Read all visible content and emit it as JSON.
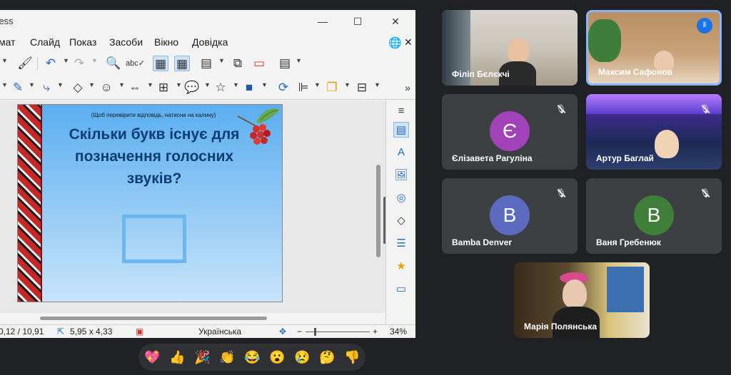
{
  "impress": {
    "title": "ress",
    "menu": [
      "мат",
      "Слайд",
      "Показ",
      "Засоби",
      "Вікно",
      "Довідка"
    ]
  },
  "slide": {
    "hint": "(Щоб перевірити відповідь, натисни на калину)",
    "title": "Скільки букв існує для позначення голосних звуків?"
  },
  "status": {
    "position": "0,12 / 10,91",
    "size": "5,95 x 4,33",
    "language": "Українська",
    "zoom": "34%"
  },
  "participants": [
    {
      "name": "Філіп Бєлєкчі",
      "type": "video"
    },
    {
      "name": "Максим Сафонов",
      "type": "video",
      "speaking": true
    },
    {
      "name": "Єлізавета Рагуліна",
      "type": "avatar",
      "initial": "Є",
      "color": "#a142b8",
      "muted": true
    },
    {
      "name": "Артур Баглай",
      "type": "video",
      "muted": true
    },
    {
      "name": "Bamba Denver",
      "type": "avatar",
      "initial": "B",
      "color": "#5c6bc0",
      "muted": true
    },
    {
      "name": "Ваня Гребенюк",
      "type": "avatar",
      "initial": "B",
      "color": "#3f7f3a",
      "muted": true
    },
    {
      "name": "Марія Полянська",
      "type": "video"
    }
  ],
  "reactions": [
    "💖",
    "👍",
    "🎉",
    "👏",
    "😂",
    "😮",
    "😢",
    "🤔",
    "👎"
  ],
  "colors": {
    "background": "#202124",
    "tile": "#3c4043",
    "speaking_border": "#8ab4f8",
    "slide_title": "#0d3d73"
  }
}
